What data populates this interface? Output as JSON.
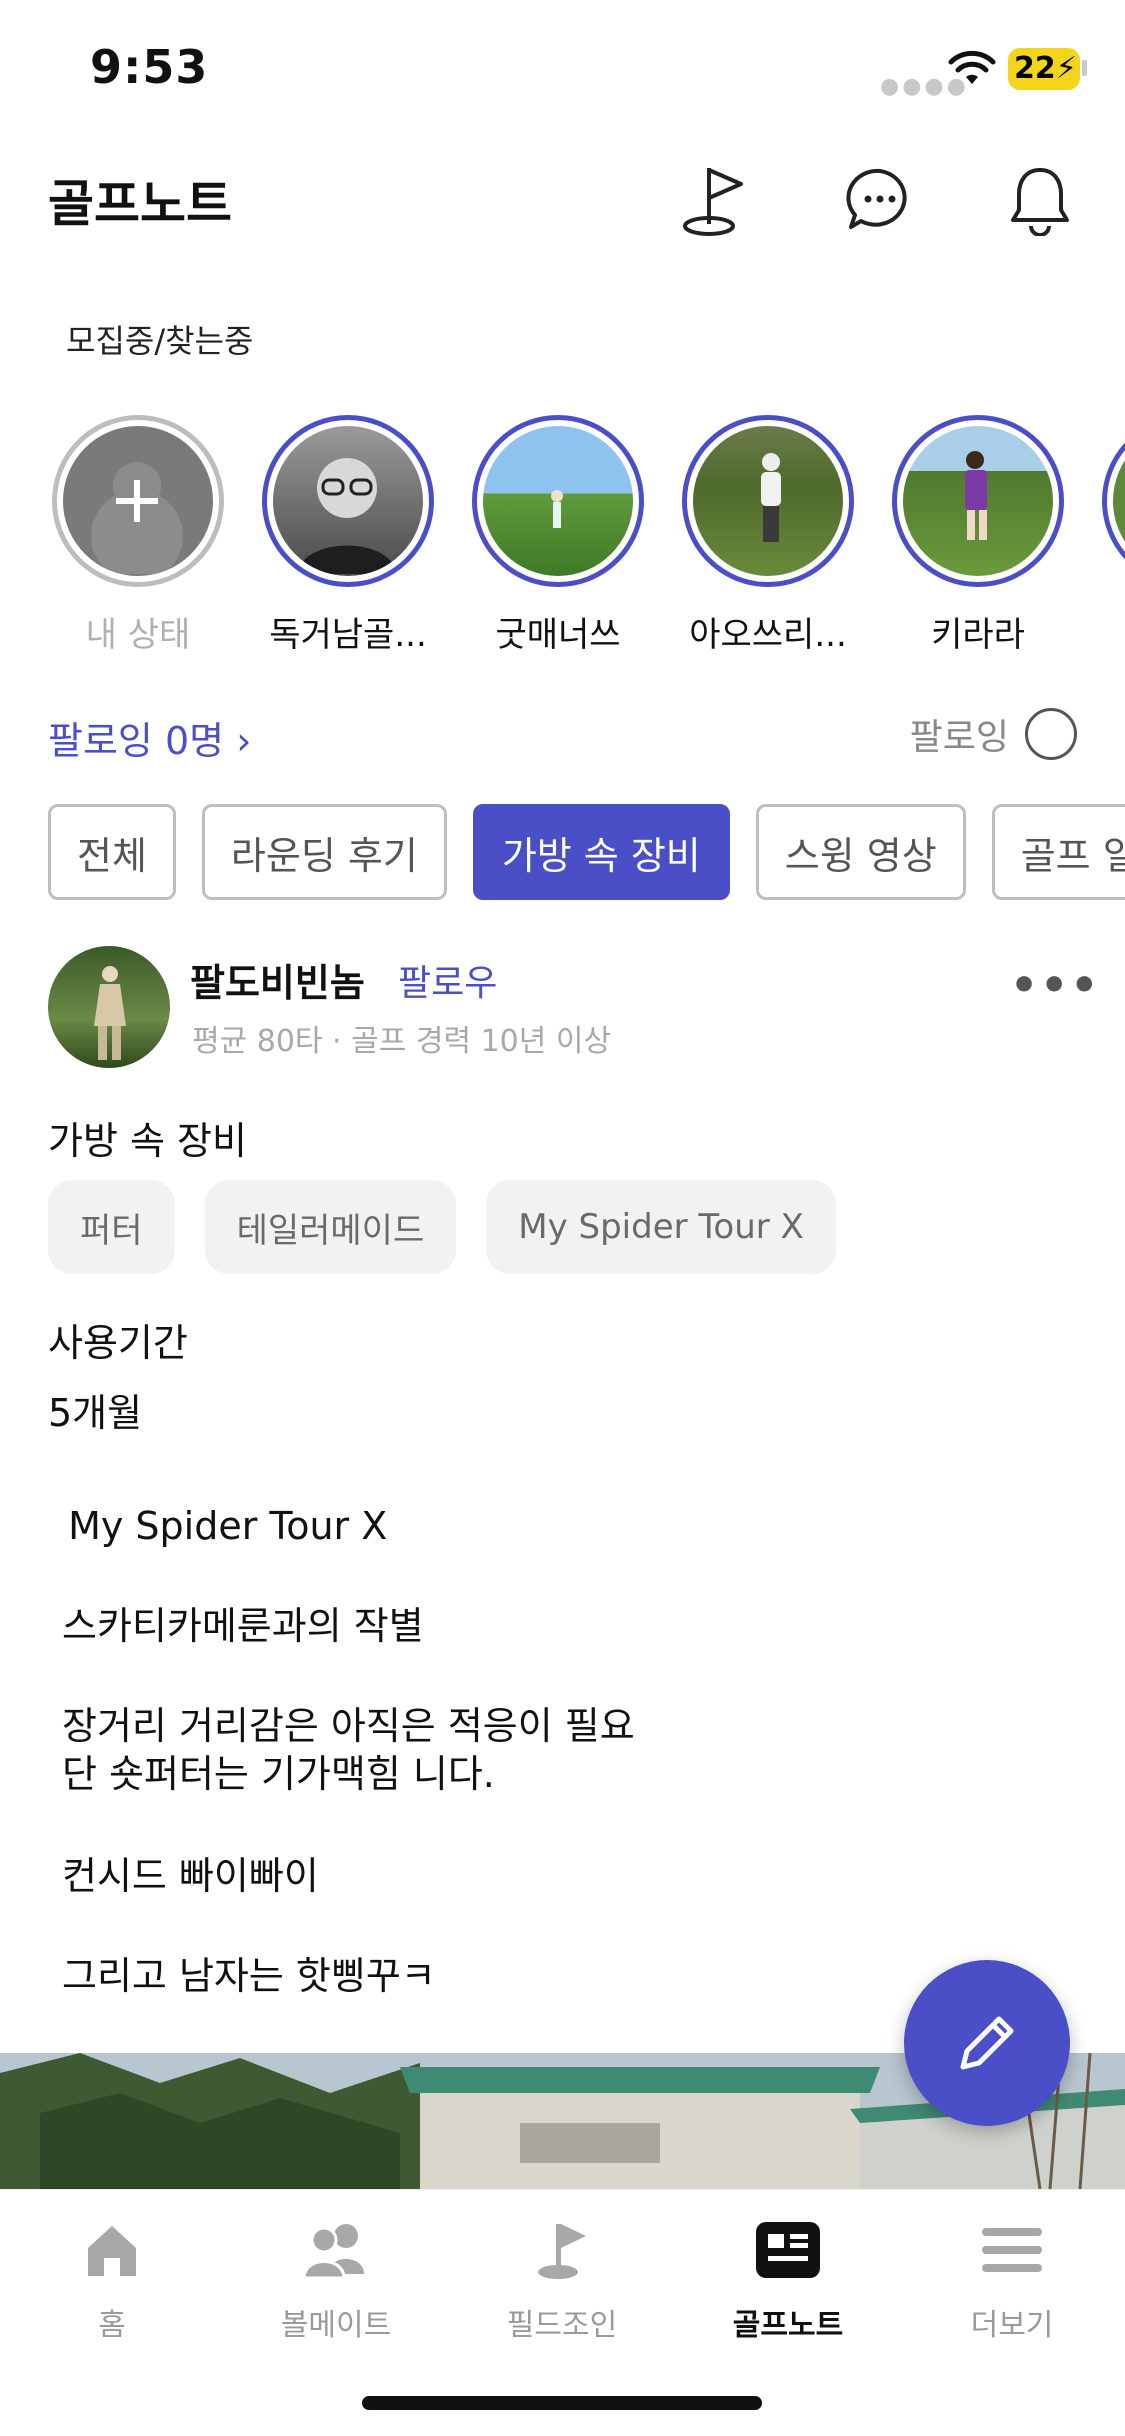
{
  "status_bar": {
    "time": "9:53",
    "battery": "22"
  },
  "header": {
    "title": "골프노트",
    "icons": [
      "flag-icon",
      "chat-icon",
      "bell-icon"
    ]
  },
  "recruiting_label": "모집중/찾는중",
  "stories": [
    {
      "name": "내 상태",
      "type": "add"
    },
    {
      "name": "독거남골..."
    },
    {
      "name": "굿매너쓰"
    },
    {
      "name": "아오쓰리..."
    },
    {
      "name": "키라라"
    }
  ],
  "following": {
    "link_label": "팔로잉 0명",
    "toggle_label": "팔로잉"
  },
  "filters": [
    {
      "label": "전체",
      "active": false
    },
    {
      "label": "라운딩 후기",
      "active": false
    },
    {
      "label": "가방 속 장비",
      "active": true
    },
    {
      "label": "스윙 영상",
      "active": false
    },
    {
      "label": "골프 일상",
      "active": false
    }
  ],
  "post": {
    "author": "팔도비빈놈",
    "follow_label": "팔로우",
    "meta": "평균 80타 · 골프 경력 10년 이상",
    "equipment_heading": "가방 속 장비",
    "tags": [
      "퍼터",
      "테일러메이드",
      "My Spider Tour X"
    ],
    "period_heading": "사용기간",
    "period_value": "5개월",
    "body": [
      " My Spider Tour X",
      "스카티카메룬과의 작별",
      "장거리 거리감은 아직은 적응이 필요\n단 숏퍼터는 기가맥힘 니다.",
      "컨시드 빠이빠이",
      "그리고 남자는 핫삥꾸ㅋ"
    ]
  },
  "bottom_nav": [
    {
      "label": "홈",
      "icon": "home-icon",
      "active": false
    },
    {
      "label": "볼메이트",
      "icon": "people-icon",
      "active": false
    },
    {
      "label": "필드조인",
      "icon": "flag-icon",
      "active": false
    },
    {
      "label": "골프노트",
      "icon": "note-icon",
      "active": true
    },
    {
      "label": "더보기",
      "icon": "menu-icon",
      "active": false
    }
  ],
  "colors": {
    "accent": "#4a4fc8",
    "chip_border": "#bfbfbf",
    "tag_bg": "#f2f2f2"
  }
}
